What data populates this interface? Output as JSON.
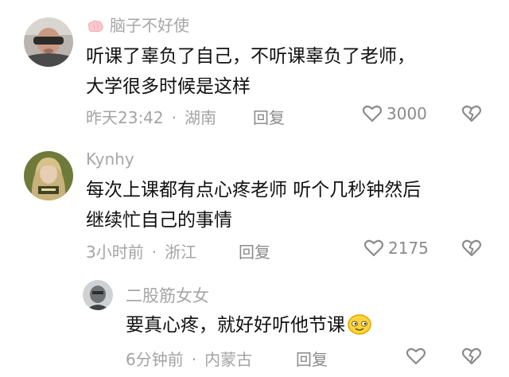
{
  "comments": [
    {
      "username": "脑子不好使",
      "line1": "听课了辜负了自己，不听课辜负了老师，",
      "line2": "大学很多时候是这样",
      "time": "昨天23:42",
      "location": "湖南",
      "reply_label": "回复",
      "likes": "3000"
    },
    {
      "username": "Kynhy",
      "line1": "每次上课都有点心疼老师 听个几秒钟然后",
      "line2": "继续忙自己的事情",
      "time": "3小时前",
      "location": "浙江",
      "reply_label": "回复",
      "likes": "2175"
    },
    {
      "username": "二股筋女女",
      "line1": "要真心疼，就好好听他节课",
      "time": "6分钟前",
      "location": "内蒙古",
      "reply_label": "回复"
    }
  ],
  "separator": "·",
  "colors": {
    "text": "#111111",
    "meta": "#a3a3a3",
    "icon": "#8a8a8a"
  },
  "icons": [
    "brain-icon",
    "heart-icon",
    "broken-heart-icon",
    "smile-emoji-icon"
  ]
}
